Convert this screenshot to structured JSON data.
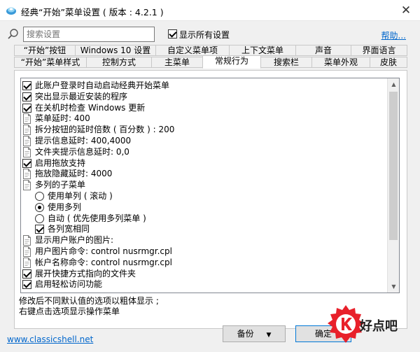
{
  "window": {
    "title": "经典“开始”菜单设置 ( 版本 : 4.2.1 )",
    "close_glyph": "✕"
  },
  "search": {
    "placeholder": "搜索设置",
    "show_all_label": "显示所有设置",
    "show_all_checked": true,
    "help_link": "帮助..."
  },
  "tabs": {
    "row1": [
      "“开始”按钮",
      "Windows 10 设置",
      "自定义菜单项",
      "上下文菜单",
      "声音",
      "界面语言"
    ],
    "row2": [
      "“开始”菜单样式",
      "控制方式",
      "主菜单",
      "常规行为",
      "搜索栏",
      "菜单外观",
      "皮肤"
    ],
    "active": "常规行为"
  },
  "settings": [
    {
      "type": "checkbox",
      "checked": true,
      "label": "此账户登录时自动启动经典开始菜单"
    },
    {
      "type": "checkbox",
      "checked": true,
      "label": "突出显示最近安装的程序"
    },
    {
      "type": "checkbox",
      "checked": true,
      "label": "在关机时检查 Windows 更新"
    },
    {
      "type": "value",
      "label": "菜单延时: 400"
    },
    {
      "type": "value",
      "label": "拆分按钮的延时倍数 ( 百分数 ) : 200"
    },
    {
      "type": "value",
      "label": "提示信息延时: 400,4000"
    },
    {
      "type": "value",
      "label": "文件夹提示信息延时: 0,0"
    },
    {
      "type": "checkbox",
      "checked": true,
      "label": "启用拖放支持"
    },
    {
      "type": "value",
      "label": "拖放隐藏延时: 4000"
    },
    {
      "type": "value",
      "label": "多列的子菜单"
    },
    {
      "type": "radio",
      "checked": false,
      "label": "使用单列 ( 滚动 )"
    },
    {
      "type": "radio",
      "checked": true,
      "label": "使用多列"
    },
    {
      "type": "radio",
      "checked": false,
      "label": "自动 ( 优先使用多列菜单 )"
    },
    {
      "type": "checkbox",
      "checked": true,
      "label": "各列宽相同"
    },
    {
      "type": "value",
      "label": "显示用户账户的图片:"
    },
    {
      "type": "value",
      "label": "用户图片命令: control nusrmgr.cpl"
    },
    {
      "type": "value",
      "label": "帐户名称命令: control nusrmgr.cpl"
    },
    {
      "type": "checkbox",
      "checked": true,
      "label": "展开快捷方式指向的文件夹"
    },
    {
      "type": "checkbox",
      "checked": true,
      "label": "启用轻松访问功能"
    }
  ],
  "hints": {
    "line1": "修改后不同默认值的选项以粗体显示 ;",
    "line2": "右键点击选项显示操作菜单"
  },
  "footer": {
    "site_link": "www.classicshell.net",
    "backup_label": "备份",
    "ok_label": "确定"
  },
  "watermark": {
    "text": "好点吧"
  },
  "colors": {
    "link": "#0066cc",
    "watermark_red": "#e8202a"
  }
}
